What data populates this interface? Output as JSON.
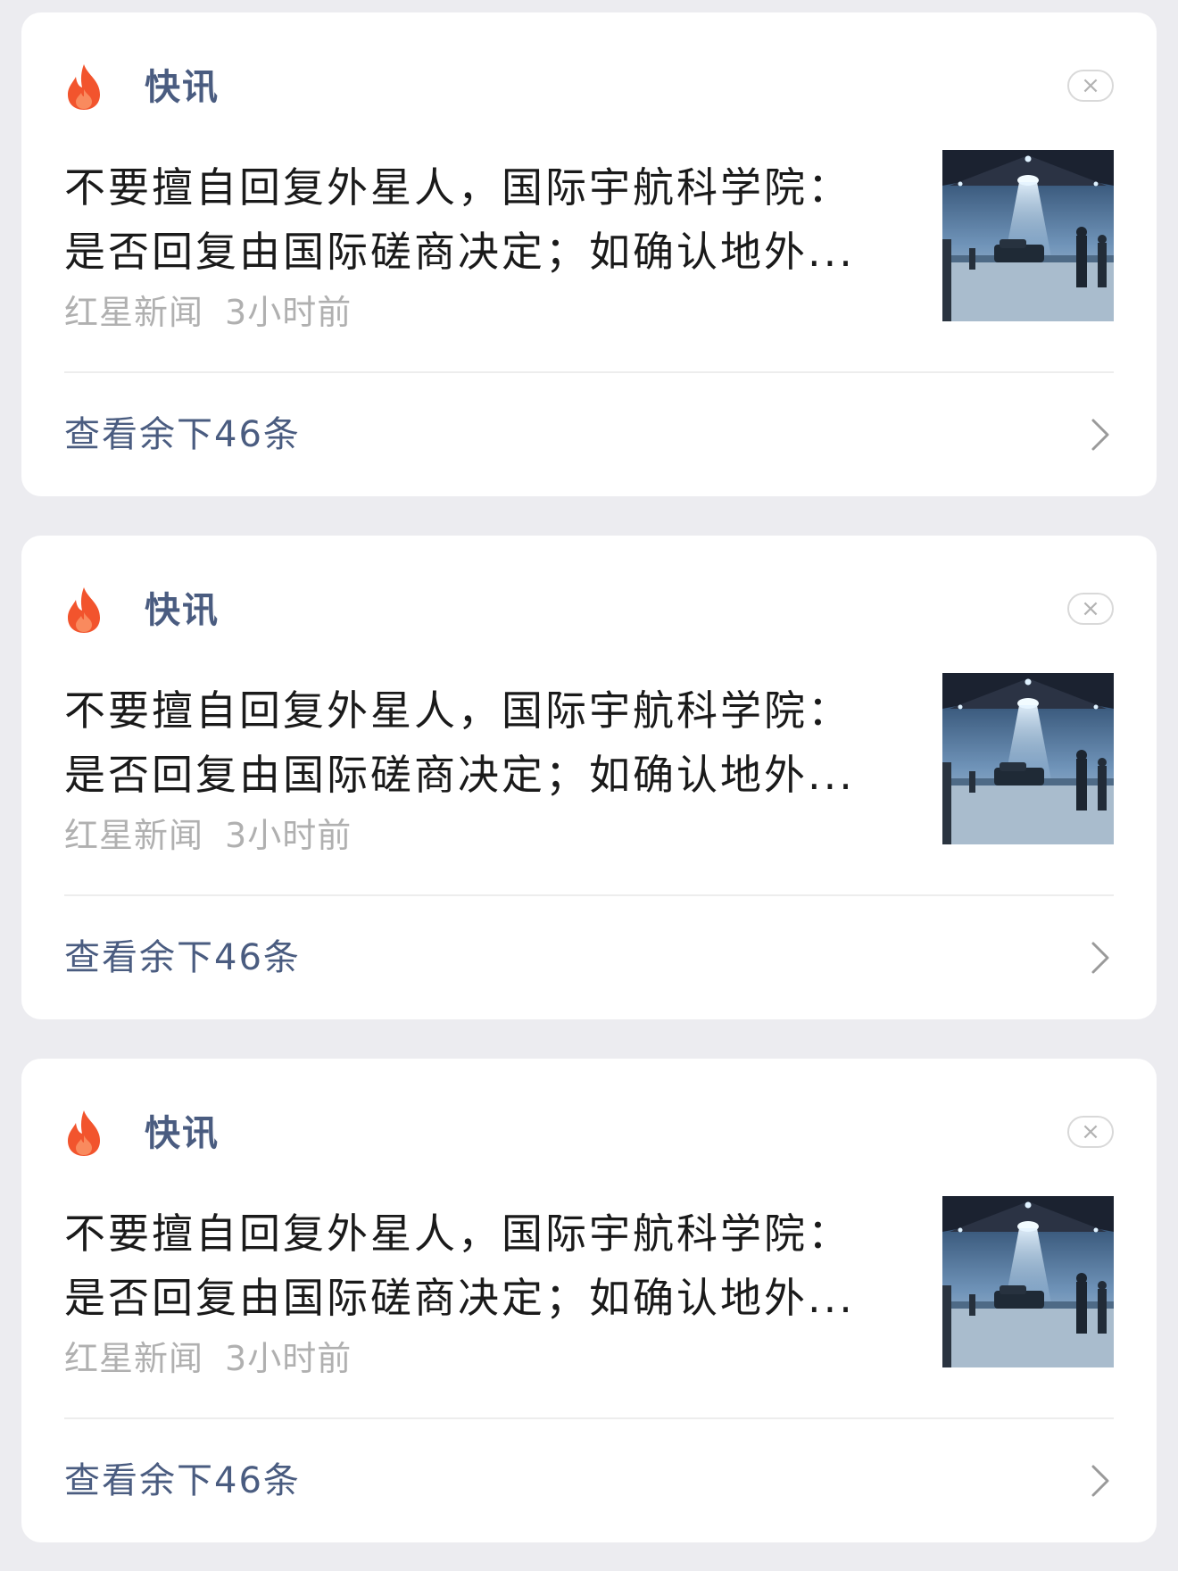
{
  "colors": {
    "background": "#ececf0",
    "card": "#ffffff",
    "accent": "#4a5c80",
    "fire": "#f2542d",
    "headline": "#1a1a1a",
    "meta": "#b0b0b0"
  },
  "icons": {
    "fire": "fire-icon",
    "close": "close-icon",
    "chevron": "chevron-right-icon"
  },
  "cards": [
    {
      "section_title": "快讯",
      "close_glyph": "×",
      "headline": "不要擅自回复外星人，国际宇航科学院：是否回复由国际磋商决定；如确认地外...",
      "source": "红星新闻",
      "time": "3小时前",
      "more_label": "查看余下46条"
    },
    {
      "section_title": "快讯",
      "close_glyph": "×",
      "headline": "不要擅自回复外星人，国际宇航科学院：是否回复由国际磋商决定；如确认地外...",
      "source": "红星新闻",
      "time": "3小时前",
      "more_label": "查看余下46条"
    },
    {
      "section_title": "快讯",
      "close_glyph": "×",
      "headline": "不要擅自回复外星人，国际宇航科学院：是否回复由国际磋商决定；如确认地外...",
      "source": "红星新闻",
      "time": "3小时前",
      "more_label": "查看余下46条"
    }
  ]
}
